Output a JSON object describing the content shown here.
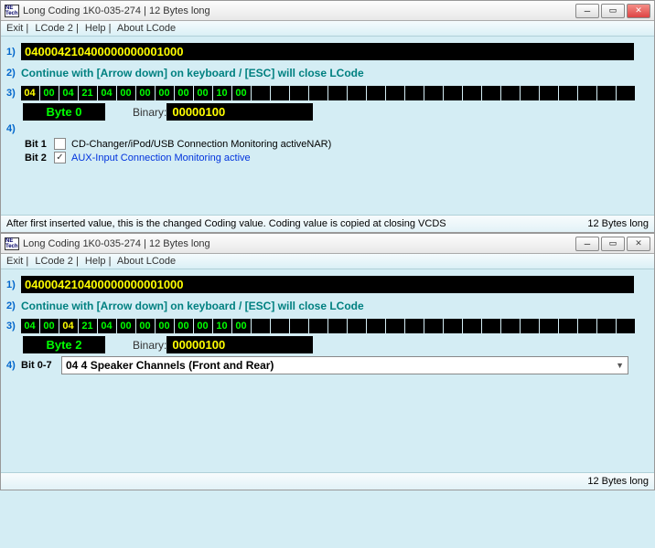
{
  "top": {
    "title": "Long Coding  1K0-035-274 | 12 Bytes long",
    "icon": "NE Tech",
    "menu": {
      "exit": "Exit |",
      "lcode2": "LCode 2 |",
      "help": "Help |",
      "about": "About LCode"
    },
    "row1_label": "1)",
    "coding": "040004210400000000001000",
    "row2_label": "2)",
    "hint": "Continue with [Arrow down] on keyboard / [ESC] will close LCode",
    "row3_label": "3)",
    "bytes": [
      "04",
      "00",
      "04",
      "21",
      "04",
      "00",
      "00",
      "00",
      "00",
      "00",
      "10",
      "00"
    ],
    "selected_byte": 0,
    "byte_label": "Byte 0",
    "binary_label": "Binary:",
    "binary": "00000100",
    "row4_label": "4)",
    "bit1_label": "Bit 1",
    "bit1_text": "CD-Changer/iPod/USB Connection Monitoring activeNAR)",
    "bit1_checked": false,
    "bit2_label": "Bit 2",
    "bit2_text": "AUX-Input Connection Monitoring active",
    "bit2_checked": true,
    "status_left": "After first inserted value, this is the changed Coding value.  Coding value is copied at closing VCDS",
    "status_right": "12 Bytes long"
  },
  "bottom": {
    "title": "Long Coding  1K0-035-274 | 12 Bytes long",
    "icon": "NE Tech",
    "menu": {
      "exit": "Exit |",
      "lcode2": "LCode 2 |",
      "help": "Help |",
      "about": "About LCode"
    },
    "row1_label": "1)",
    "coding": "040004210400000000001000",
    "row2_label": "2)",
    "hint": "Continue with [Arrow down] on keyboard / [ESC] will close LCode",
    "row3_label": "3)",
    "bytes": [
      "04",
      "00",
      "04",
      "21",
      "04",
      "00",
      "00",
      "00",
      "00",
      "00",
      "10",
      "00"
    ],
    "selected_byte": 2,
    "byte_label": "Byte 2",
    "binary_label": "Binary:",
    "binary": "00000100",
    "row4_label": "4)",
    "bit07_label": "Bit 0-7",
    "dropdown": "04 4 Speaker Channels (Front and Rear)",
    "status_left": "",
    "status_right": "12 Bytes long"
  }
}
